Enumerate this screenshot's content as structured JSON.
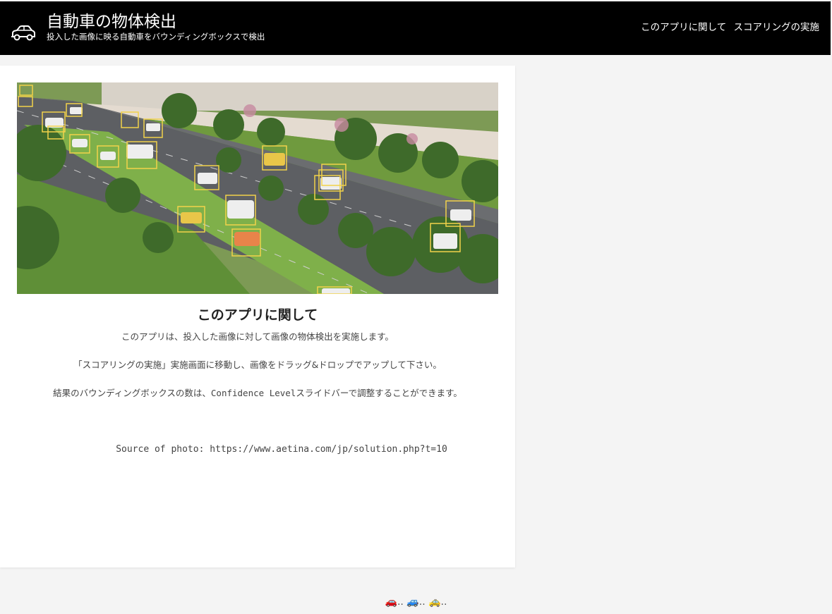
{
  "header": {
    "title": "自動車の物体検出",
    "subtitle": "投入した画像に映る自動車をバウンディングボックスで検出",
    "icon": "car-icon",
    "nav": [
      {
        "label": "このアプリに関して"
      },
      {
        "label": "スコアリングの実施"
      }
    ]
  },
  "about": {
    "title": "このアプリに関して",
    "p1": "このアプリは、投入した画像に対して画像の物体検出を実施します。",
    "p2": "「スコアリングの実施」実施画面に移動し、画像をドラッグ&ドロップでアップして下さい。",
    "p3_before": "結果のバウンディングボックスの数は、",
    "p3_code": "Confidence Level",
    "p3_after": "スライドバーで調整することができます。",
    "source": "Source of photo: https://www.aetina.com/jp/solution.php?t=10"
  },
  "footer": {
    "text": "🚗.. 🚙.. 🚕.."
  },
  "colors": {
    "header_bg": "#000000",
    "bbox": "#f2d24a",
    "page_bg": "#f4f4f4"
  }
}
